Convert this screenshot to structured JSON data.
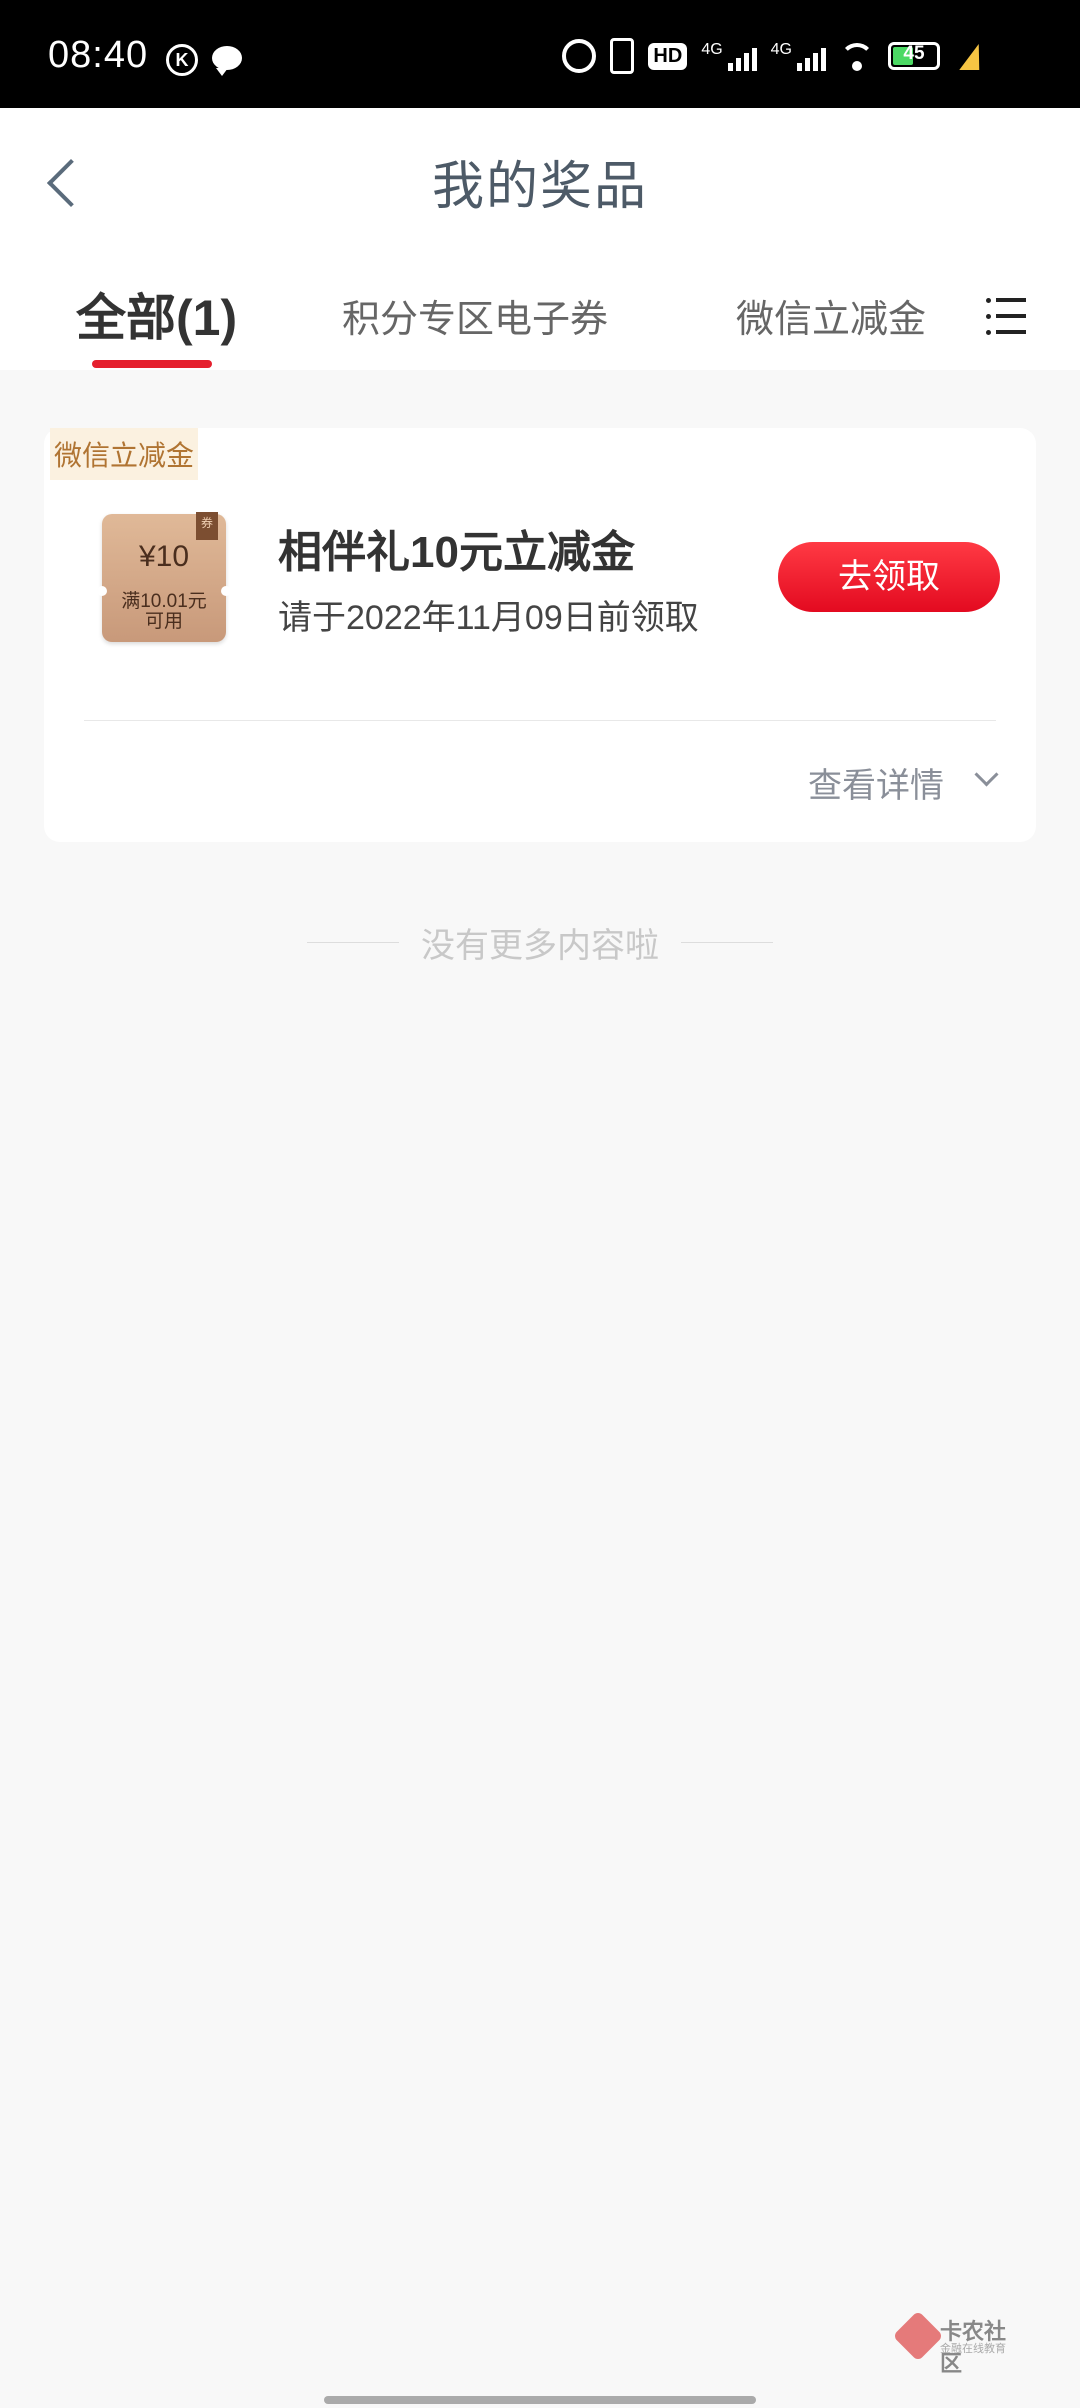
{
  "status_bar": {
    "time": "08:40",
    "k_label": "K",
    "hd_label": "HD",
    "network_1": "4G",
    "network_2": "4G",
    "battery": "45"
  },
  "header": {
    "title": "我的奖品"
  },
  "tabs": [
    {
      "label": "全部(1)",
      "active": true
    },
    {
      "label": "积分专区电子券",
      "active": false
    },
    {
      "label": "微信立减金",
      "active": false
    }
  ],
  "prize_card": {
    "tag": "微信立减金",
    "coupon": {
      "amount": "¥10",
      "condition_line1": "满10.01元",
      "condition_line2": "可用",
      "corner_label": "券"
    },
    "name": "相伴礼10元立减金",
    "deadline": "请于2022年11月09日前领取",
    "claim_label": "去领取",
    "details_label": "查看详情"
  },
  "footer": {
    "no_more": "没有更多内容啦"
  },
  "watermark": {
    "name": "卡农社区",
    "tagline": "金融在线教育"
  },
  "colors": {
    "accent_red": "#e5202e",
    "tag_text": "#b07432",
    "tag_bg": "#fbf1e0"
  }
}
